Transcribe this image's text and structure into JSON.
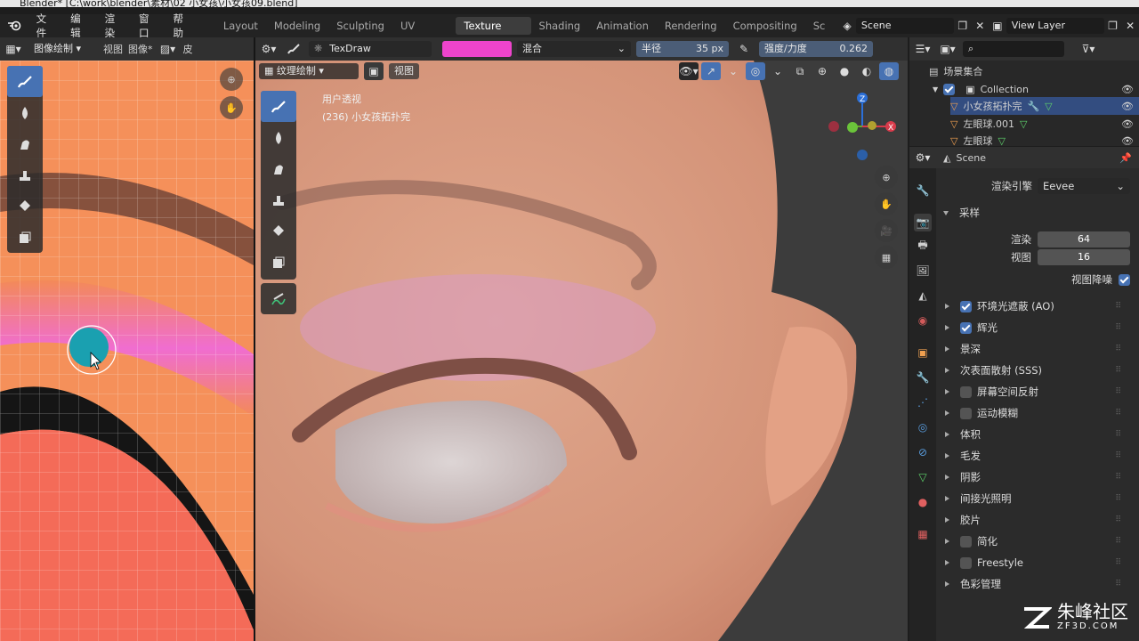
{
  "window": {
    "title": "Blender* [C:\\work\\blender\\素材\\02 小女孩\\小女孩09.blend]"
  },
  "menu": {
    "items": [
      "文件",
      "编辑",
      "渲染",
      "窗口",
      "帮助"
    ]
  },
  "workspaces": {
    "tabs": [
      "Layout",
      "Modeling",
      "Sculpting",
      "UV Editing",
      "Texture Paint",
      "Shading",
      "Animation",
      "Rendering",
      "Compositing",
      "Sc"
    ],
    "active": "Texture Paint"
  },
  "scene": {
    "name": "Scene",
    "view_layer": "View Layer"
  },
  "uv_editor": {
    "mode": "图像绘制",
    "menus": [
      "视图",
      "图像*"
    ],
    "extra": "皮"
  },
  "tool_header": {
    "brush": "TexDraw",
    "color": "#ee44cc",
    "blend": "混合",
    "radius_label": "半径",
    "radius_value": "35 px",
    "strength_label": "强度/力度",
    "strength_value": "0.262"
  },
  "viewport": {
    "mode": "纹理绘制",
    "view_menu": "视图",
    "info_line1": "用户透视",
    "info_line2": "(236) 小女孩拓扑完"
  },
  "outliner": {
    "root": "场景集合",
    "collection": "Collection",
    "objects": [
      "小女孩拓扑完",
      "左眼球.001",
      "左眼球"
    ]
  },
  "properties": {
    "scene_label": "Scene",
    "render_engine_label": "渲染引擎",
    "render_engine": "Eevee",
    "sampling": {
      "title": "采样",
      "render_label": "渲染",
      "render_value": "64",
      "viewport_label": "视图",
      "viewport_value": "16",
      "denoise_label": "视图降噪"
    },
    "panels": [
      {
        "label": "环境光遮蔽 (AO)",
        "checkbox": true,
        "checked": true
      },
      {
        "label": "辉光",
        "checkbox": true,
        "checked": true
      },
      {
        "label": "景深",
        "checkbox": false
      },
      {
        "label": "次表面散射 (SSS)",
        "checkbox": false
      },
      {
        "label": "屏幕空间反射",
        "checkbox": true,
        "checked": false
      },
      {
        "label": "运动模糊",
        "checkbox": true,
        "checked": false
      },
      {
        "label": "体积",
        "checkbox": false
      },
      {
        "label": "毛发",
        "checkbox": false
      },
      {
        "label": "阴影",
        "checkbox": false
      },
      {
        "label": "间接光照明",
        "checkbox": false
      },
      {
        "label": "胶片",
        "checkbox": false
      },
      {
        "label": "简化",
        "checkbox": true,
        "checked": false
      },
      {
        "label": "Freestyle",
        "checkbox": true,
        "checked": false
      },
      {
        "label": "色彩管理",
        "checkbox": false
      }
    ]
  },
  "watermark": {
    "main": "朱峰社区",
    "sub": "ZF3D.COM"
  }
}
